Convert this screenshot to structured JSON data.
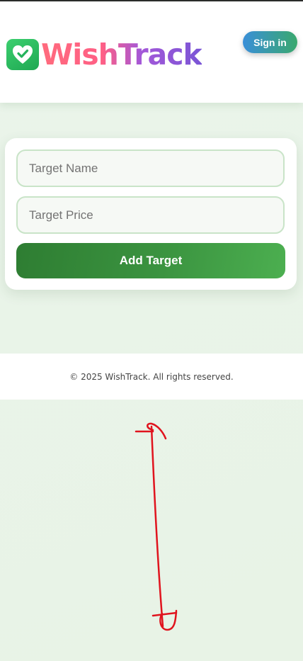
{
  "header": {
    "logo_text": "WishTrack",
    "logo_icon": "heart-check-icon",
    "signin_label": "Sign in"
  },
  "form": {
    "name_placeholder": "Target Name",
    "price_placeholder": "Target Price",
    "add_label": "Add Target"
  },
  "footer": {
    "copyright": "© 2025 WishTrack. All rights reserved."
  },
  "colors": {
    "accent_green": "#2e7d32",
    "field_border": "#c9e4c8",
    "annotation_red": "#e0141e"
  }
}
